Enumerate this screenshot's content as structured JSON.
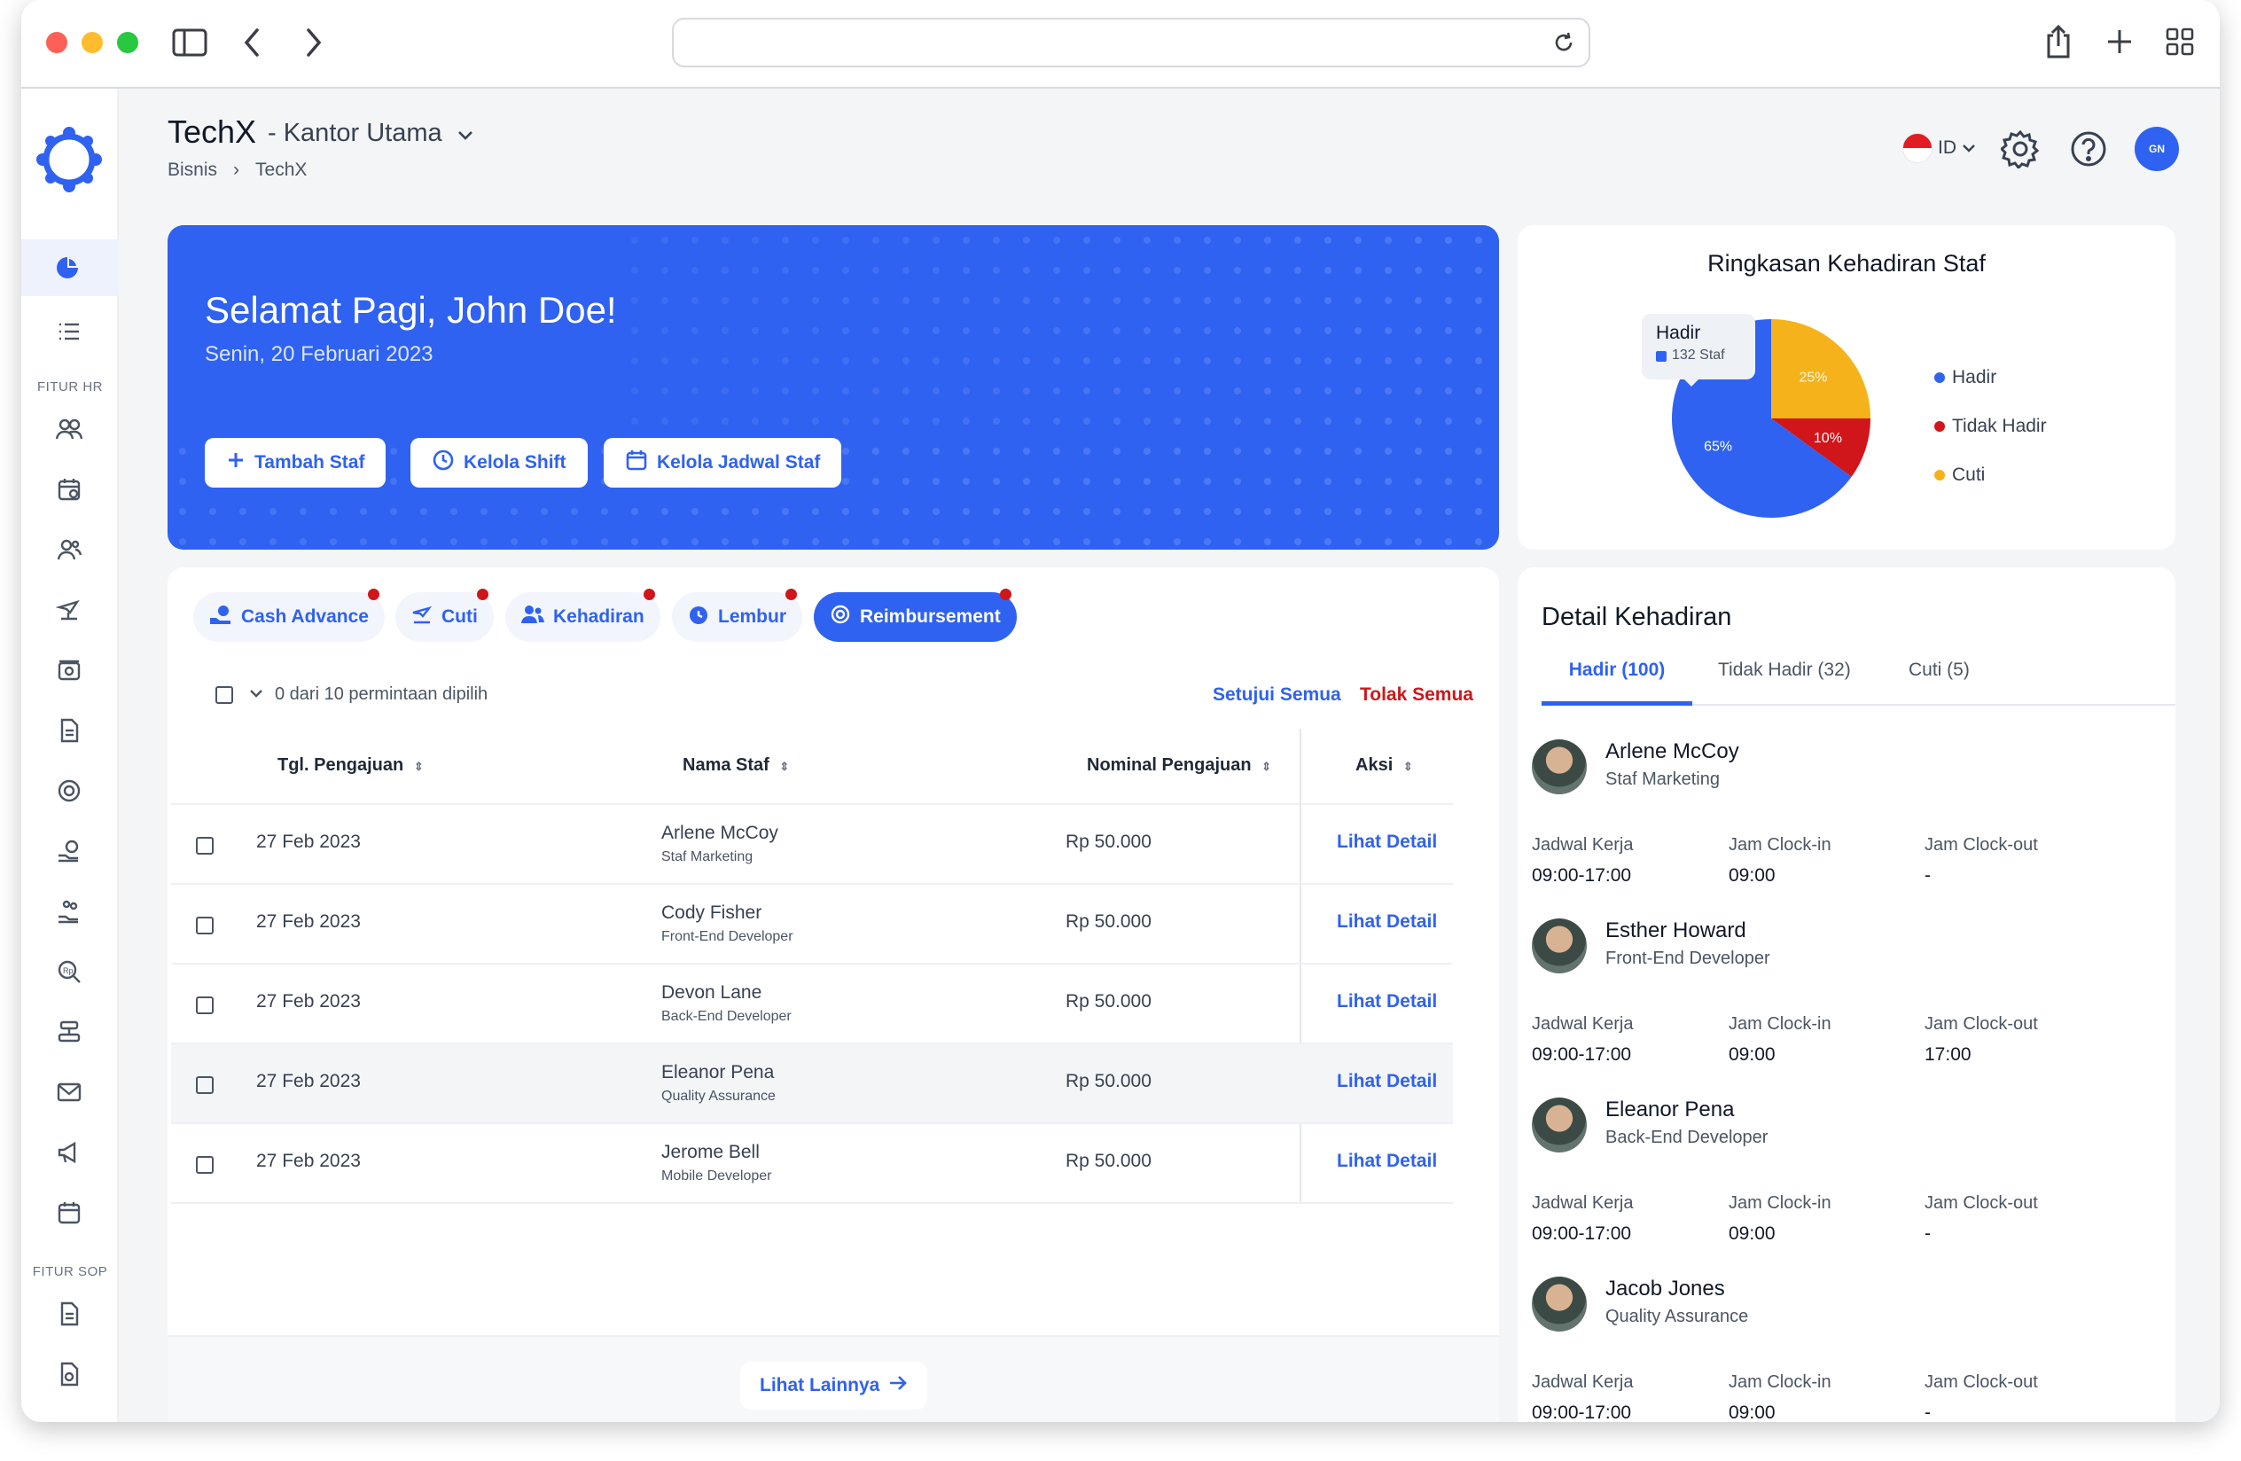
{
  "header": {
    "company": "TechX",
    "branch": "- Kantor Utama",
    "breadcrumb": [
      "Bisnis",
      "TechX"
    ],
    "lang": "ID",
    "avatar_initials": "GN"
  },
  "sidebar": {
    "section_hr": "FITUR HR",
    "section_sop": "FITUR SOP"
  },
  "hero": {
    "greeting": "Selamat Pagi, John Doe!",
    "date": "Senin, 20 Februari 2023",
    "buttons": [
      "Tambah Staf",
      "Kelola Shift",
      "Kelola Jadwal Staf"
    ]
  },
  "summary": {
    "title": "Ringkasan Kehadiran Staf",
    "tooltip": {
      "label": "Hadir",
      "value": "132 Staf"
    },
    "legend": [
      "Hadir",
      "Tidak Hadir",
      "Cuti"
    ]
  },
  "chart_data": {
    "type": "pie",
    "title": "Ringkasan Kehadiran Staf",
    "categories": [
      "Hadir",
      "Tidak Hadir",
      "Cuti"
    ],
    "values": [
      65,
      10,
      25
    ],
    "labels": [
      "65%",
      "10%",
      "25%"
    ],
    "colors": [
      "#2f62f0",
      "#d0161a",
      "#f5b21a"
    ],
    "legend_position": "right"
  },
  "requests": {
    "tabs": [
      "Cash Advance",
      "Cuti",
      "Kehadiran",
      "Lembur",
      "Reimbursement"
    ],
    "active_tab": "Reimbursement",
    "selection": "0 dari 10 permintaan dipilih",
    "approve_all": "Setujui Semua",
    "reject_all": "Tolak Semua",
    "columns": [
      "Tgl. Pengajuan",
      "Nama Staf",
      "Nominal Pengajuan",
      "Aksi"
    ],
    "rows": [
      {
        "date": "27 Feb 2023",
        "name": "Arlene McCoy",
        "role": "Staf Marketing",
        "amount": "Rp 50.000",
        "action": "Lihat Detail"
      },
      {
        "date": "27 Feb 2023",
        "name": "Cody Fisher",
        "role": "Front-End Developer",
        "amount": "Rp 50.000",
        "action": "Lihat Detail"
      },
      {
        "date": "27 Feb 2023",
        "name": "Devon Lane",
        "role": "Back-End Developer",
        "amount": "Rp 50.000",
        "action": "Lihat Detail"
      },
      {
        "date": "27 Feb 2023",
        "name": "Eleanor Pena",
        "role": "Quality Assurance",
        "amount": "Rp 50.000",
        "action": "Lihat Detail"
      },
      {
        "date": "27 Feb 2023",
        "name": "Jerome Bell",
        "role": "Mobile Developer",
        "amount": "Rp 50.000",
        "action": "Lihat Detail"
      }
    ],
    "more": "Lihat Lainnya"
  },
  "attendance": {
    "title": "Detail Kehadiran",
    "tabs": [
      "Hadir (100)",
      "Tidak Hadir (32)",
      "Cuti (5)"
    ],
    "col_labels": [
      "Jadwal Kerja",
      "Jam Clock-in",
      "Jam Clock-out"
    ],
    "employees": [
      {
        "name": "Arlene McCoy",
        "role": "Staf Marketing",
        "schedule": "09:00-17:00",
        "clock_in": "09:00",
        "clock_out": "-"
      },
      {
        "name": "Esther Howard",
        "role": "Front-End Developer",
        "schedule": "09:00-17:00",
        "clock_in": "09:00",
        "clock_out": "17:00"
      },
      {
        "name": "Eleanor Pena",
        "role": "Back-End Developer",
        "schedule": "09:00-17:00",
        "clock_in": "09:00",
        "clock_out": "-"
      },
      {
        "name": "Jacob Jones",
        "role": "Quality Assurance",
        "schedule": "09:00-17:00",
        "clock_in": "09:00",
        "clock_out": "-"
      }
    ]
  }
}
